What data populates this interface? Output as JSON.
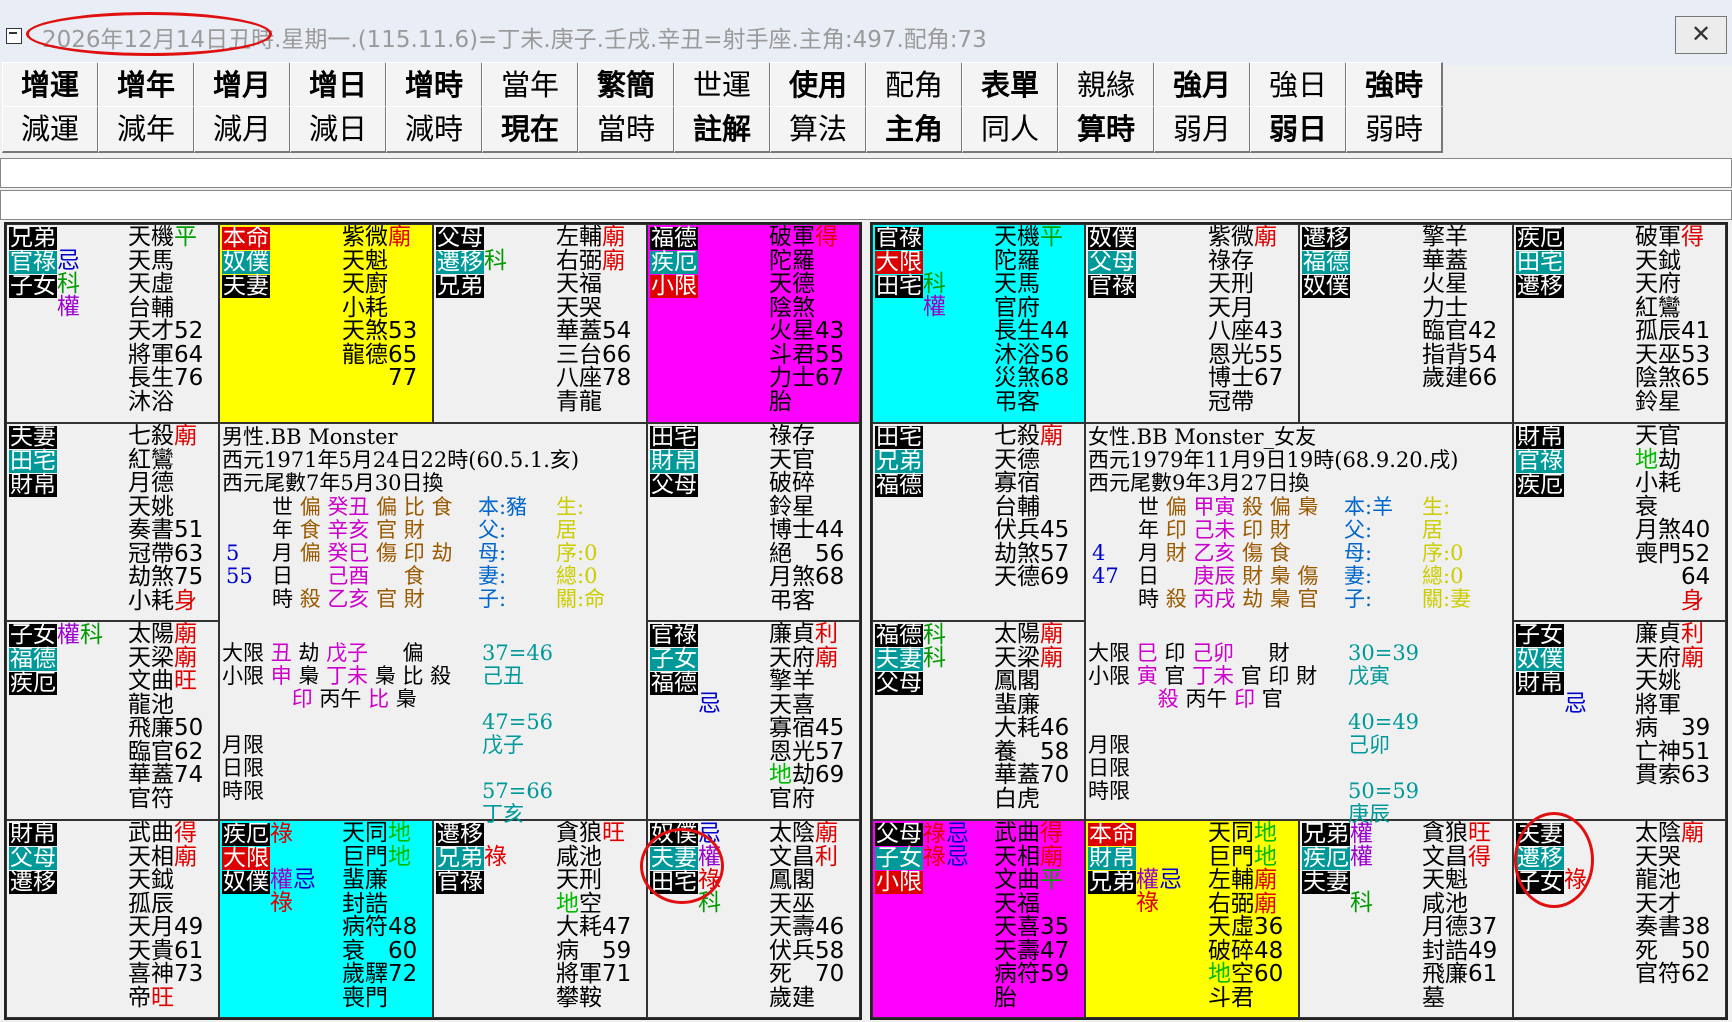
{
  "title": "2026年12月14日丑時.星期一.(115.11.6)=丁未.庚子.壬戌.辛丑=射手座.主角:497.配角:73",
  "close_label": "✕",
  "toolbar": {
    "row1": [
      "增運",
      "增年",
      "增月",
      "增日",
      "增時",
      "當年",
      "繁簡",
      "世運",
      "使用",
      "配角",
      "表單",
      "親緣",
      "強月",
      "強日",
      "強時"
    ],
    "row2": [
      "減運",
      "減年",
      "減月",
      "減日",
      "減時",
      "現在",
      "當時",
      "註解",
      "算法",
      "主角",
      "同人",
      "算時",
      "弱月",
      "弱日",
      "弱時"
    ]
  },
  "chart_left": {
    "cells": [
      {
        "labels": [
          "兄弟",
          "官祿",
          "子女"
        ],
        "marks": "\n忌\n科\n權",
        "stars": "天機平\n天馬\n天虛\n台輔\n天才52\n將軍64\n長生76\n沐浴",
        "bg": "#f0f0f0"
      },
      {
        "labels": [
          "本命",
          "奴僕",
          "夫妻"
        ],
        "marks": "",
        "stars": "紫微廟\n天魁\n天廚\n小耗\n天煞53\n龍德65\n　　77",
        "bg": "#ffff00"
      },
      {
        "labels": [
          "父母",
          "遷移",
          "兄弟"
        ],
        "marks": "\n科",
        "stars": "左輔廟\n右弼廟\n天福\n天哭\n華蓋54\n三台66\n八座78\n青龍",
        "bg": "#f0f0f0"
      },
      {
        "labels": [
          "福德",
          "疾厄",
          "小限"
        ],
        "marks": "",
        "stars": "破軍得\n陀羅\n天德\n陰煞\n火星43\n斗君55\n力士67\n胎",
        "bg": "#ff00ff"
      },
      {
        "labels": [
          "夫妻",
          "田宅",
          "財帛"
        ],
        "marks": "",
        "stars": "七殺廟\n紅鸞\n月德\n天姚\n奏書51\n冠帶63\n劫煞75\n小耗身",
        "bg": "#f0f0f0"
      },
      {
        "labels": [
          "田宅",
          "財帛",
          "父母"
        ],
        "marks": "",
        "stars": "祿存\n天官\n破碎\n鈴星\n博士44\n絕　56\n月煞68\n弔客",
        "bg": "#f0f0f0"
      },
      {
        "labels": [
          "子女",
          "福德",
          "疾厄"
        ],
        "marks": "權科",
        "stars": "太陽廟\n天梁廟\n文曲旺\n龍池\n飛廉50\n臨官62\n華蓋74\n官符",
        "bg": "#f0f0f0"
      },
      {
        "labels": [
          "官祿",
          "子女",
          "福德"
        ],
        "marks": "\n\n\n忌",
        "stars": "廉貞利\n天府廟\n擎羊\n天喜\n寡宿45\n恩光57\n地劫69\n官府",
        "bg": "#f0f0f0"
      },
      {
        "labels": [
          "財帛",
          "父母",
          "遷移"
        ],
        "marks": "",
        "stars": "武曲得\n天相廟\n天鉞\n孤辰\n天月49\n天貴61\n喜神73\n帝旺",
        "bg": "#f0f0f0"
      },
      {
        "labels": [
          "疾厄",
          "大限",
          "奴僕"
        ],
        "marks": "祿\n\n權忌\n祿",
        "stars": "天同地\n巨門地\n蜚廉\n封誥\n病符48\n衰　60\n歲驛72\n喪門",
        "bg": "#00ffff"
      },
      {
        "labels": [
          "遷移",
          "兄弟",
          "官祿"
        ],
        "marks": "\n祿",
        "stars": "貪狼旺\n咸池\n天刑\n地空\n大耗47\n病　59\n將軍71\n攀鞍",
        "bg": "#f0f0f0"
      },
      {
        "labels": [
          "奴僕",
          "夫妻",
          "田宅"
        ],
        "marks": "忌\n權\n祿\n科",
        "stars": "太陰廟\n文昌利\n鳳閣\n天巫\n天壽46\n伏兵58\n死　70\n歲建",
        "bg": "#f0f0f0"
      }
    ],
    "center": {
      "line1": "男性.BB Monster",
      "line2": "西元1971年5月24日22時(60.5.1.亥)",
      "line3": "西元尾數7年5月30日換",
      "pillars": "世 偏 癸丑 偏 比 食\n年 食 辛亥 官 財\n月 偏 癸巳 傷 印 劫\n日 　 己酉 　 食\n時 殺 乙亥 官 財",
      "nums": "5\n55",
      "rel": "本:豬\n父:\n母:\n妻:\n子:",
      "life": "生:\n居\n序:0\n總:0\n關:命",
      "luck": "大限 丑 劫 戊子 　 偏\n小限 申 梟 丁未 梟 比 殺\n　　　 印 丙午 比 梟\n\n月限\n日限\n時限",
      "ages": "37=46\n己丑\n\n47=56\n戊子\n\n57=66\n丁亥"
    }
  },
  "chart_right": {
    "cells": [
      {
        "labels": [
          "官祿",
          "大限",
          "田宅"
        ],
        "marks": "\n\n科\n權",
        "stars": "天機平\n陀羅\n天馬\n官府\n長生44\n沐浴56\n災煞68\n弔客",
        "bg": "#00ffff"
      },
      {
        "labels": [
          "奴僕",
          "父母",
          "官祿"
        ],
        "marks": "",
        "stars": "紫微廟\n祿存\n天刑\n天月\n八座43\n恩光55\n博士67\n冠帶",
        "bg": "#f0f0f0"
      },
      {
        "labels": [
          "遷移",
          "福德",
          "奴僕"
        ],
        "marks": "",
        "stars": "擎羊\n華蓋\n火星\n力士\n臨官42\n指背54\n歲建66",
        "bg": "#f0f0f0"
      },
      {
        "labels": [
          "疾厄",
          "田宅",
          "遷移"
        ],
        "marks": "",
        "stars": "破軍得\n天鉞\n天府\n紅鸞\n孤辰41\n天巫53\n陰煞65\n鈴星",
        "bg": "#f0f0f0"
      },
      {
        "labels": [
          "田宅",
          "兄弟",
          "福德"
        ],
        "marks": "",
        "stars": "七殺廟\n天德\n寡宿\n台輔\n伏兵45\n劫煞57\n天德69",
        "bg": "#f0f0f0"
      },
      {
        "labels": [
          "財帛",
          "官祿",
          "疾厄"
        ],
        "marks": "",
        "stars": "天官\n地劫\n小耗\n衰\n月煞40\n喪門52\n　　64\n　　身",
        "bg": "#f0f0f0"
      },
      {
        "labels": [
          "福德",
          "夫妻",
          "父母"
        ],
        "marks": "科\n科",
        "stars": "太陽廟\n天梁廟\n鳳閣\n蜚廉\n大耗46\n養　58\n華蓋70\n白虎",
        "bg": "#f0f0f0"
      },
      {
        "labels": [
          "子女",
          "奴僕",
          "財帛"
        ],
        "marks": "\n\n\n忌",
        "stars": "廉貞利\n天府廟\n天姚\n將軍\n病　39\n亡神51\n貫索63",
        "bg": "#f0f0f0"
      },
      {
        "labels": [
          "父母",
          "子女",
          "小限"
        ],
        "marks": "祿忌\n祿忌",
        "stars": "武曲得\n天相廟\n文曲平\n天福\n天喜35\n天壽47\n病符59\n胎",
        "bg": "#ff00ff"
      },
      {
        "labels": [
          "本命",
          "財帛",
          "兄弟"
        ],
        "marks": "\n\n權忌\n祿",
        "stars": "天同地\n巨門地\n左輔廟\n右弼廟\n天虛36\n破碎48\n地空60\n斗君",
        "bg": "#ffff00"
      },
      {
        "labels": [
          "兄弟",
          "疾厄",
          "夫妻"
        ],
        "marks": "權\n權\n\n科",
        "stars": "貪狼旺\n文昌得\n天魁\n咸池\n月德37\n封誥49\n飛廉61\n墓",
        "bg": "#f0f0f0"
      },
      {
        "labels": [
          "夫妻",
          "遷移",
          "子女"
        ],
        "marks": "\n\n祿",
        "stars": "太陰廟\n天哭\n龍池\n天才\n奏書38\n死　50\n官符62",
        "bg": "#f0f0f0"
      }
    ],
    "center": {
      "line1": "女性.BB Monster_女友",
      "line2": "西元1979年11月9日19時(68.9.20.戌)",
      "line3": "西元尾數9年3月27日換",
      "pillars": "世 偏 甲寅 殺 偏 梟\n年 印 己未 印 財\n月 財 乙亥 傷 食\n日 　 庚辰 財 梟 傷\n時 殺 丙戌 劫 梟 官",
      "nums": "4\n47",
      "rel": "本:羊\n父:\n母:\n妻:\n子:",
      "life": "生:\n居\n序:0\n總:0\n關:妻",
      "luck": "大限 巳 印 己卯 　 財\n小限 寅 官 丁未 官 印 財\n　　　 殺 丙午 印 官\n\n月限\n日限\n時限",
      "ages": "30=39\n戊寅\n\n40=49\n己卯\n\n50=59\n庚辰"
    }
  }
}
